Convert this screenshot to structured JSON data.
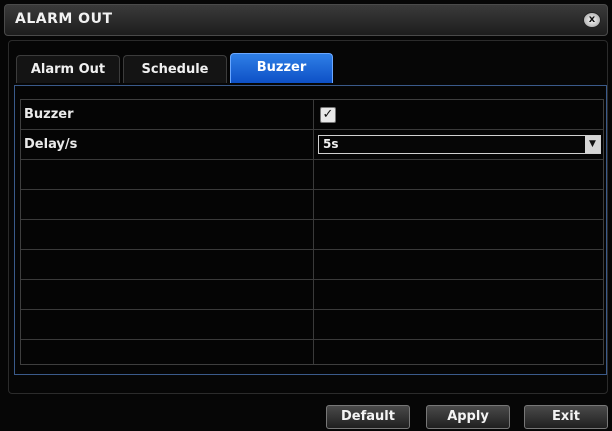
{
  "window": {
    "title": "ALARM OUT",
    "close_symbol": "x"
  },
  "tabs": [
    {
      "label": "Alarm Out",
      "active": false
    },
    {
      "label": "Schedule",
      "active": false
    },
    {
      "label": "Buzzer",
      "active": true
    }
  ],
  "buzzer": {
    "buzzer_label": "Buzzer",
    "buzzer_checked": true,
    "check_glyph": "✓",
    "delay_label": "Delay/s",
    "delay_value": "5s",
    "dropdown_glyph": "▼"
  },
  "buttons": {
    "default": "Default",
    "apply": "Apply",
    "exit": "Exit"
  },
  "colors": {
    "active_tab": "#1463d8",
    "background": "#050505"
  }
}
